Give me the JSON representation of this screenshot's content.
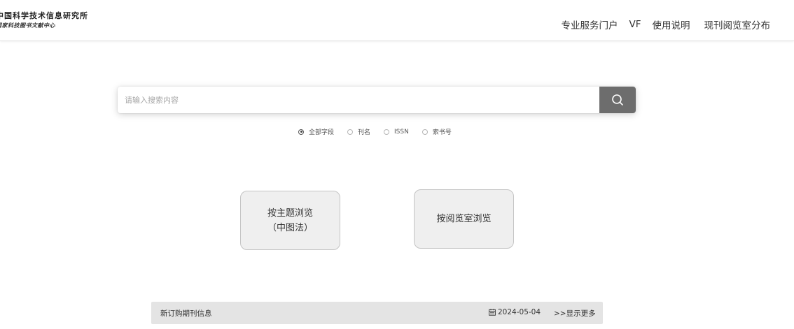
{
  "header": {
    "logo": {
      "line1": "中国科学技术信息研究所",
      "line2": "国家科技图书文献中心"
    },
    "nav": {
      "portal": "专业服务门户",
      "vf": "VF",
      "instructions": "使用说明",
      "distribution": "现刊阅览室分布"
    }
  },
  "search": {
    "placeholder": "请输入搜索内容",
    "button_icon": "search-icon"
  },
  "search_fields": {
    "all": "全部字段",
    "title": "刊名",
    "issn": "ISSN",
    "callno": "索书号",
    "selected": "全部字段"
  },
  "browse": {
    "subject_line1": "按主题浏览",
    "subject_line2": "（中图法）",
    "room": "按阅览室浏览"
  },
  "news": {
    "title": "新订购期刊信息",
    "date": "2024-05-04",
    "date_icon": "calendar-icon",
    "more": ">>显示更多"
  },
  "colors": {
    "search_button": "#6d6d6d",
    "browse_button_bg": "#efefef",
    "news_bar_bg": "#e4e4e4",
    "text": "#333333"
  }
}
